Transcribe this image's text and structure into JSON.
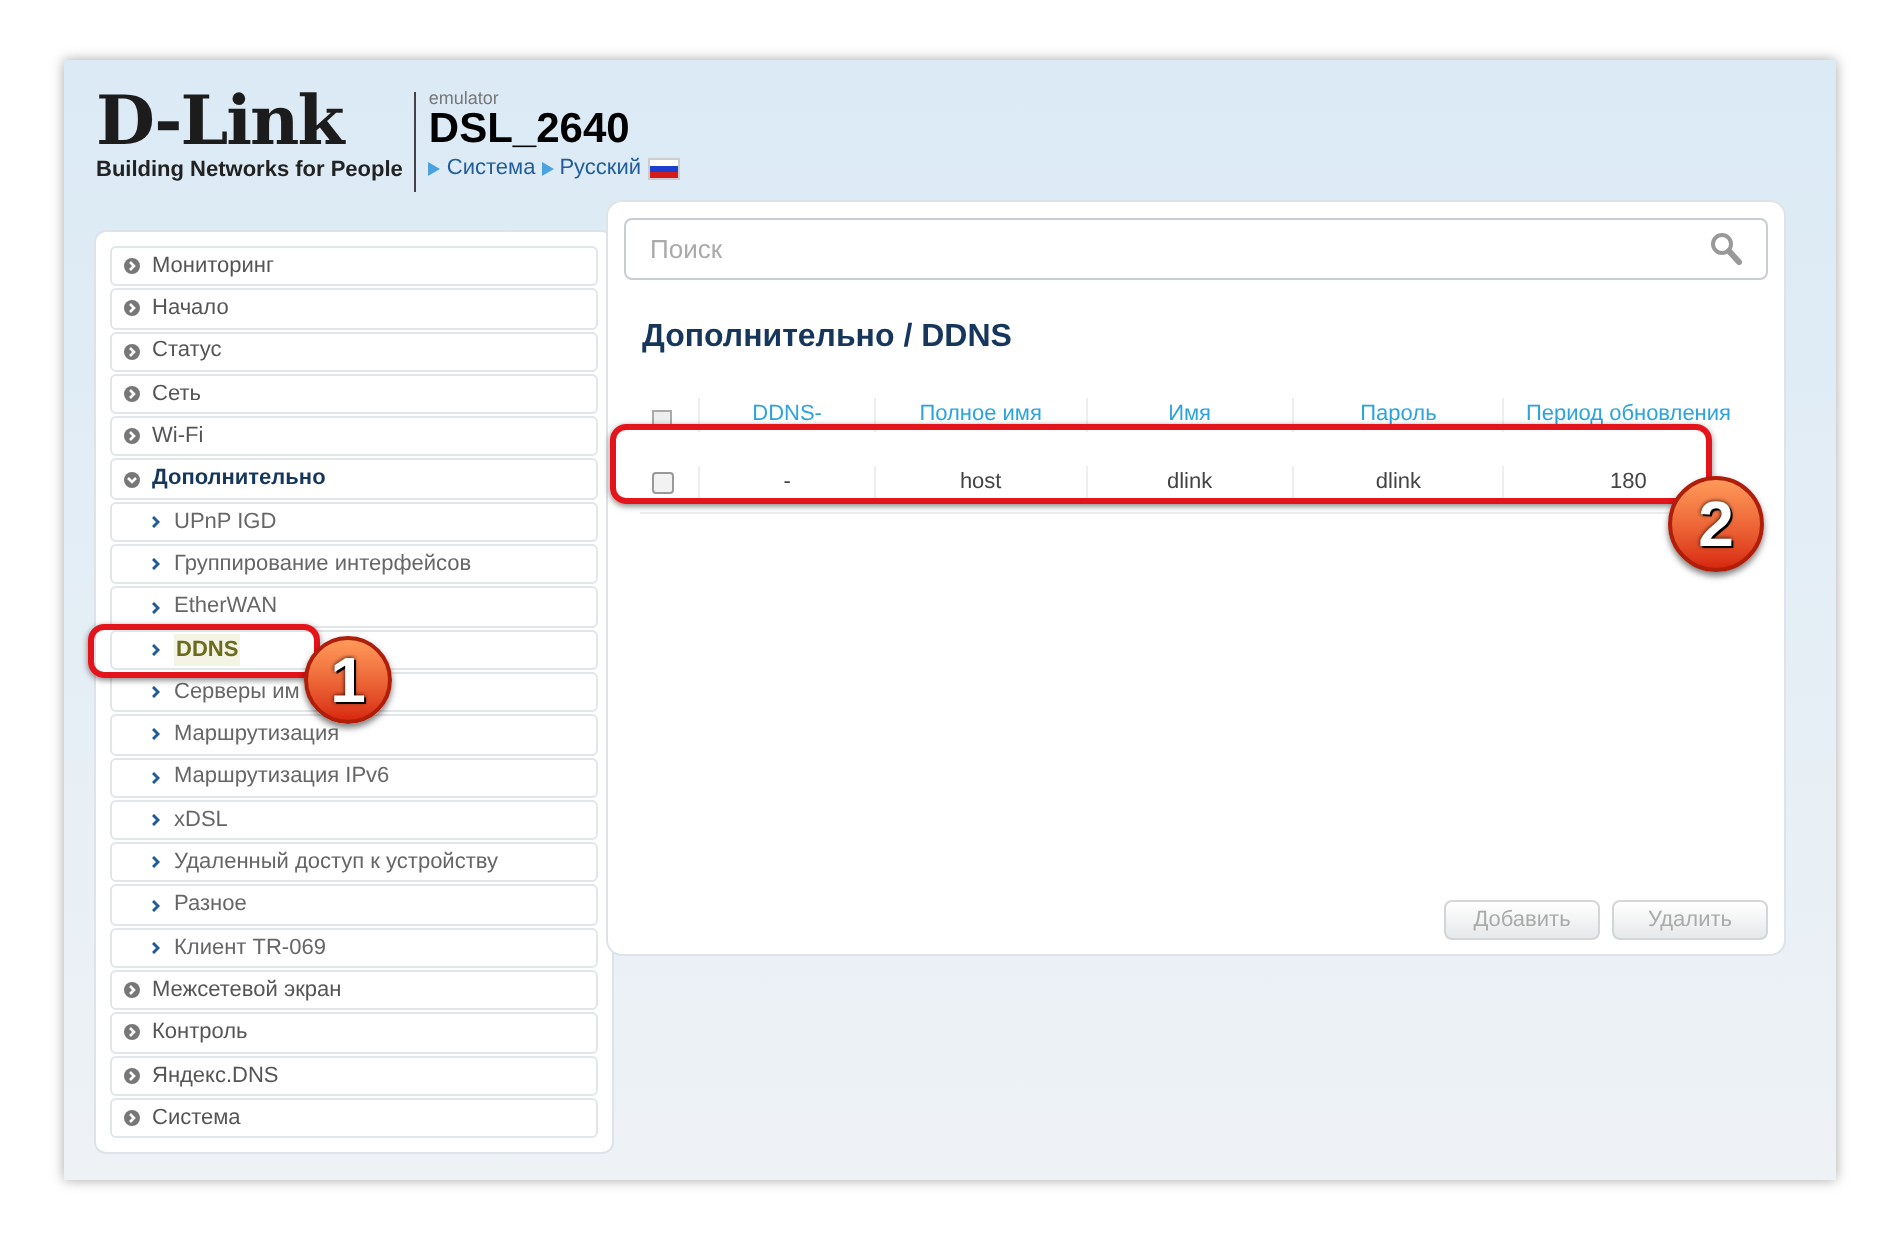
{
  "header": {
    "brand": "D-Link",
    "tagline": "Building Networks for People",
    "emulator_label": "emulator",
    "model": "DSL_2640",
    "links": [
      "Система",
      "Русский"
    ]
  },
  "sidebar": {
    "items": [
      {
        "label": "Мониторинг",
        "expanded": false
      },
      {
        "label": "Начало",
        "expanded": false
      },
      {
        "label": "Статус",
        "expanded": false
      },
      {
        "label": "Сеть",
        "expanded": false
      },
      {
        "label": "Wi-Fi",
        "expanded": false
      },
      {
        "label": "Дополнительно",
        "expanded": true,
        "children": [
          {
            "label": "UPnP IGD",
            "selected": false
          },
          {
            "label": "Группирование интерфейсов",
            "selected": false
          },
          {
            "label": "EtherWAN",
            "selected": false
          },
          {
            "label": "DDNS",
            "selected": true
          },
          {
            "label": "Серверы им",
            "selected": false
          },
          {
            "label": "Маршрутизация",
            "selected": false
          },
          {
            "label": "Маршрутизация IPv6",
            "selected": false
          },
          {
            "label": "xDSL",
            "selected": false
          },
          {
            "label": "Удаленный доступ к устройству",
            "selected": false
          },
          {
            "label": "Разное",
            "selected": false
          },
          {
            "label": "Клиент TR-069",
            "selected": false
          }
        ]
      },
      {
        "label": "Межсетевой экран",
        "expanded": false
      },
      {
        "label": "Контроль",
        "expanded": false
      },
      {
        "label": "Яндекс.DNS",
        "expanded": false
      },
      {
        "label": "Система",
        "expanded": false
      }
    ]
  },
  "search": {
    "placeholder": "Поиск"
  },
  "breadcrumb": "Дополнительно /  DDNS",
  "table": {
    "header_checked": false,
    "columns": [
      "DDNS-",
      "Полное имя",
      "Имя",
      "Пароль",
      "Период обновления"
    ],
    "rows": [
      {
        "checked": false,
        "cells": [
          "-",
          "host",
          "dlink",
          "dlink",
          "180"
        ]
      }
    ]
  },
  "buttons": [
    {
      "label": "Добавить",
      "disabled": true
    },
    {
      "label": "Удалить",
      "disabled": true
    }
  ],
  "annotations": [
    {
      "number": "1"
    },
    {
      "number": "2"
    }
  ]
}
